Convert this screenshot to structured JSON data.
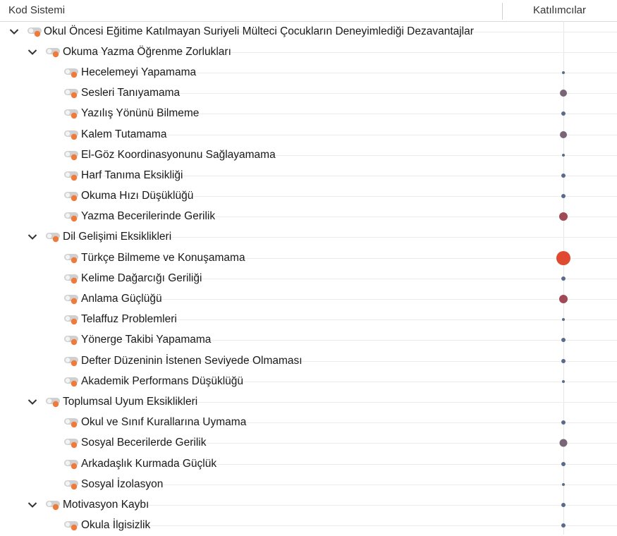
{
  "header": {
    "code_system": "Kod Sistemi",
    "participants": "Katılımcılar"
  },
  "colors": {
    "accent": "#f07a3a",
    "toggle": "#d0d0d0",
    "dot_low": "#5a6a8c",
    "dot_mid": "#7a6478",
    "dot_high": "#a04a55",
    "dot_max": "#e04a30"
  },
  "rows": [
    {
      "label": "Okul Öncesi Eğitime Katılmayan Suriyeli Mülteci Çocukların Deneyimlediği Dezavantajlar",
      "level": 0,
      "expanded": true,
      "dot": null
    },
    {
      "label": "Okuma Yazma Öğrenme Zorlukları",
      "level": 1,
      "expanded": true,
      "dot": null
    },
    {
      "label": "Hecelemeyi Yapamama",
      "level": 2,
      "dot": "xs"
    },
    {
      "label": "Sesleri Tanıyamama",
      "level": 2,
      "dot": "mid"
    },
    {
      "label": "Yazılış Yönünü Bilmeme",
      "level": 2,
      "dot": "sm"
    },
    {
      "label": "Kalem Tutamama",
      "level": 2,
      "dot": "mid"
    },
    {
      "label": "El-Göz Koordinasyonunu Sağlayamama",
      "level": 2,
      "dot": "xs"
    },
    {
      "label": "Harf Tanıma Eksikliği",
      "level": 2,
      "dot": "sm"
    },
    {
      "label": "Okuma Hızı Düşüklüğü",
      "level": 2,
      "dot": "sm"
    },
    {
      "label": "Yazma Becerilerinde Gerilik",
      "level": 2,
      "dot": "high"
    },
    {
      "label": "Dil Gelişimi Eksiklikleri",
      "level": 1,
      "expanded": true,
      "dot": null
    },
    {
      "label": "Türkçe Bilmeme ve Konuşamama",
      "level": 2,
      "dot": "max"
    },
    {
      "label": "Kelime Dağarcığı Geriliği",
      "level": 2,
      "dot": "sm"
    },
    {
      "label": "Anlama Güçlüğü",
      "level": 2,
      "dot": "high"
    },
    {
      "label": "Telaffuz Problemleri",
      "level": 2,
      "dot": "xs"
    },
    {
      "label": "Yönerge Takibi Yapamama",
      "level": 2,
      "dot": "sm"
    },
    {
      "label": "Defter Düzeninin İstenen Seviyede Olmaması",
      "level": 2,
      "dot": "sm"
    },
    {
      "label": "Akademik Performans Düşüklüğü",
      "level": 2,
      "dot": "xs"
    },
    {
      "label": "Toplumsal Uyum Eksiklikleri",
      "level": 1,
      "expanded": true,
      "dot": null
    },
    {
      "label": "Okul ve Sınıf Kurallarına Uymama",
      "level": 2,
      "dot": "sm"
    },
    {
      "label": "Sosyal Becerilerde Gerilik",
      "level": 2,
      "dot": "highmid"
    },
    {
      "label": "Arkadaşlık Kurmada Güçlük",
      "level": 2,
      "dot": "sm"
    },
    {
      "label": "Sosyal İzolasyon",
      "level": 2,
      "dot": "xs"
    },
    {
      "label": "Motivasyon Kaybı",
      "level": 1,
      "expanded": true,
      "dot": "sm"
    },
    {
      "label": "Okula İlgisizlik",
      "level": 2,
      "dot": "sm"
    }
  ]
}
